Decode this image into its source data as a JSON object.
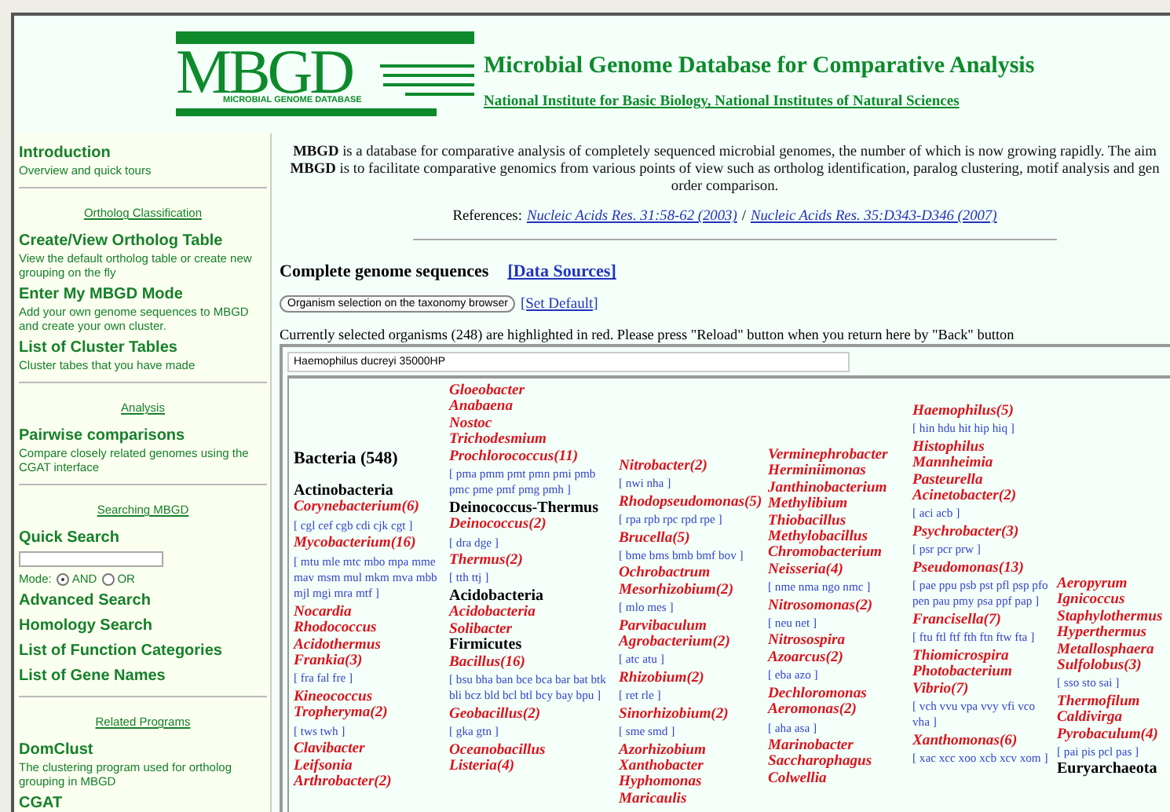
{
  "header": {
    "logo": {
      "letters": "MBGD",
      "caption": "MICROBIAL GENOME DATABASE"
    },
    "title": "Microbial Genome Database for Comparative Analysis",
    "subtitle": "National Institute for Basic Biology, National Institutes of Natural Sciences"
  },
  "sidebar": {
    "items": [
      {
        "kind": "link",
        "title": "Introduction",
        "description": "Overview and quick tours"
      },
      {
        "kind": "section",
        "label": "Ortholog Classification"
      },
      {
        "kind": "link",
        "title": "Create/View Ortholog Table",
        "description": "View the default ortholog table or create new grouping on the fly"
      },
      {
        "kind": "link",
        "title": "Enter My MBGD Mode",
        "description": "Add your own genome sequences to MBGD and create your own cluster."
      },
      {
        "kind": "link",
        "title": "List of Cluster Tables",
        "description": "Cluster tabes that you have made"
      },
      {
        "kind": "section",
        "label": "Analysis"
      },
      {
        "kind": "link",
        "title": "Pairwise comparisons",
        "description": "Compare closely related genomes using the CGAT interface"
      },
      {
        "kind": "section",
        "label": "Searching MBGD"
      },
      {
        "kind": "search",
        "title": "Quick Search",
        "mode_label": "Mode:",
        "options": [
          {
            "label": "AND",
            "selected": true
          },
          {
            "label": "OR",
            "selected": false
          }
        ]
      },
      {
        "kind": "link",
        "title": "Advanced Search"
      },
      {
        "kind": "link",
        "title": "Homology Search"
      },
      {
        "kind": "link",
        "title": "List of Function Categories"
      },
      {
        "kind": "link",
        "title": "List of Gene Names"
      },
      {
        "kind": "section",
        "label": "Related Programs"
      },
      {
        "kind": "link",
        "title": "DomClust",
        "description": "The clustering program used for ortholog grouping in MBGD"
      },
      {
        "kind": "link",
        "title": "CGAT"
      }
    ]
  },
  "intro": {
    "lines": [
      "**MBGD** is a database for comparative analysis of completely sequenced microbial genomes, the number of which is now growing rapidly. The aim",
      "**MBGD** is to facilitate comparative genomics from various points of view such as ortholog identification, paralog clustering, motif analysis and gen",
      "order comparison."
    ],
    "references_label": "References:",
    "references": [
      "Nucleic Acids Res. 31:58-62 (2003)",
      "Nucleic Acids Res. 35:D343-D346 (2007)"
    ],
    "separator": "/"
  },
  "genomes": {
    "heading": "Complete genome sequences",
    "data_sources": "[Data Sources]",
    "browser_button": "Organism selection on the taxonomy browser",
    "set_default": "[Set Default]",
    "notice": "Currently selected organisms (248) are highlighted in red. Please press \"Reload\" button when you return here by \"Back\" button",
    "organism_field": "Haemophilus ducreyi 35000HP",
    "columns": [
      {
        "entries": [
          {
            "kind": "domain",
            "text": "Bacteria (548)"
          },
          {
            "kind": "phylum",
            "text": "Actinobacteria"
          },
          {
            "kind": "genus",
            "text": "Corynebacterium(6)"
          },
          {
            "kind": "codes",
            "text": "[ cgl cef cgb cdi cjk cgt ]"
          },
          {
            "kind": "genus",
            "text": "Mycobacterium(16)"
          },
          {
            "kind": "codes",
            "text": "[ mtu mle mtc mbo mpa mme mav msm mul mkm mva mbb mjl mgi mra mtf ]"
          },
          {
            "kind": "genus",
            "text": "Nocardia"
          },
          {
            "kind": "genus",
            "text": "Rhodococcus"
          },
          {
            "kind": "genus",
            "text": "Acidothermus"
          },
          {
            "kind": "genus",
            "text": "Frankia(3)"
          },
          {
            "kind": "codes",
            "text": "[ fra fal fre ]"
          },
          {
            "kind": "genus",
            "text": "Kineococcus"
          },
          {
            "kind": "genus",
            "text": "Tropheryma(2)"
          },
          {
            "kind": "codes",
            "text": "[ tws twh ]"
          },
          {
            "kind": "genus",
            "text": "Clavibacter"
          },
          {
            "kind": "genus",
            "text": "Leifsonia"
          },
          {
            "kind": "genus",
            "text": "Arthrobacter(2)"
          }
        ]
      },
      {
        "entries": [
          {
            "kind": "genus",
            "text": "Gloeobacter"
          },
          {
            "kind": "genus",
            "text": "Anabaena"
          },
          {
            "kind": "genus",
            "text": "Nostoc"
          },
          {
            "kind": "genus",
            "text": "Trichodesmium"
          },
          {
            "kind": "genus",
            "text": "Prochlorococcus(11)"
          },
          {
            "kind": "codes",
            "text": "[ pma pmm pmt pmn pmi pmb pmc pme pmf pmg pmh ]"
          },
          {
            "kind": "phylum",
            "text": "Deinococcus-Thermus"
          },
          {
            "kind": "genus",
            "text": "Deinococcus(2)"
          },
          {
            "kind": "codes",
            "text": "[ dra dge ]"
          },
          {
            "kind": "genus",
            "text": "Thermus(2)"
          },
          {
            "kind": "codes",
            "text": "[ tth ttj ]"
          },
          {
            "kind": "phylum",
            "text": "Acidobacteria"
          },
          {
            "kind": "genus",
            "text": "Acidobacteria"
          },
          {
            "kind": "genus",
            "text": "Solibacter"
          },
          {
            "kind": "phylum",
            "text": "Firmicutes"
          },
          {
            "kind": "genus",
            "text": "Bacillus(16)"
          },
          {
            "kind": "codes",
            "text": "[ bsu bha ban bce bca bar bat btk bli bcz bld bcl btl bcy bay bpu ]"
          },
          {
            "kind": "genus",
            "text": "Geobacillus(2)"
          },
          {
            "kind": "codes",
            "text": "[ gka gtn ]"
          },
          {
            "kind": "genus",
            "text": "Oceanobacillus"
          },
          {
            "kind": "genus",
            "text": "Listeria(4)"
          }
        ]
      },
      {
        "entries": [
          {
            "kind": "genus",
            "text": "Nitrobacter(2)"
          },
          {
            "kind": "codes",
            "text": "[ nwi nha ]"
          },
          {
            "kind": "genus",
            "text": "Rhodopseudomonas(5)"
          },
          {
            "kind": "codes",
            "text": "[ rpa rpb rpc rpd rpe ]"
          },
          {
            "kind": "genus",
            "text": "Brucella(5)"
          },
          {
            "kind": "codes",
            "text": "[ bme bms bmb bmf bov ]"
          },
          {
            "kind": "genus",
            "text": "Ochrobactrum"
          },
          {
            "kind": "genus",
            "text": "Mesorhizobium(2)"
          },
          {
            "kind": "codes",
            "text": "[ mlo mes ]"
          },
          {
            "kind": "genus",
            "text": "Parvibaculum"
          },
          {
            "kind": "genus",
            "text": "Agrobacterium(2)"
          },
          {
            "kind": "codes",
            "text": "[ atc atu ]"
          },
          {
            "kind": "genus",
            "text": "Rhizobium(2)"
          },
          {
            "kind": "codes",
            "text": "[ ret rle ]"
          },
          {
            "kind": "genus",
            "text": "Sinorhizobium(2)"
          },
          {
            "kind": "codes",
            "text": "[ sme smd ]"
          },
          {
            "kind": "genus",
            "text": "Azorhizobium"
          },
          {
            "kind": "genus",
            "text": "Xanthobacter"
          },
          {
            "kind": "genus",
            "text": "Hyphomonas"
          },
          {
            "kind": "genus",
            "text": "Maricaulis"
          }
        ]
      },
      {
        "entries": [
          {
            "kind": "genus",
            "text": "Verminephrobacter"
          },
          {
            "kind": "genus",
            "text": "Herminiimonas"
          },
          {
            "kind": "genus",
            "text": "Janthinobacterium"
          },
          {
            "kind": "genus",
            "text": "Methylibium"
          },
          {
            "kind": "genus",
            "text": "Thiobacillus"
          },
          {
            "kind": "genus",
            "text": "Methylobacillus"
          },
          {
            "kind": "genus",
            "text": "Chromobacterium"
          },
          {
            "kind": "genus",
            "text": "Neisseria(4)"
          },
          {
            "kind": "codes",
            "text": "[ nme nma ngo nmc ]"
          },
          {
            "kind": "genus",
            "text": "Nitrosomonas(2)"
          },
          {
            "kind": "codes",
            "text": "[ neu net ]"
          },
          {
            "kind": "genus",
            "text": "Nitrosospira"
          },
          {
            "kind": "genus",
            "text": "Azoarcus(2)"
          },
          {
            "kind": "codes",
            "text": "[ eba azo ]"
          },
          {
            "kind": "genus",
            "text": "Dechloromonas"
          },
          {
            "kind": "genus",
            "text": "Aeromonas(2)"
          },
          {
            "kind": "codes",
            "text": "[ aha asa ]"
          },
          {
            "kind": "genus",
            "text": "Marinobacter"
          },
          {
            "kind": "genus",
            "text": "Saccharophagus"
          },
          {
            "kind": "genus",
            "text": "Colwellia"
          }
        ]
      },
      {
        "entries": [
          {
            "kind": "genus",
            "text": "Haemophilus(5)"
          },
          {
            "kind": "codes",
            "text": "[ hin hdu hit hip hiq ]"
          },
          {
            "kind": "genus",
            "text": "Histophilus"
          },
          {
            "kind": "genus",
            "text": "Mannheimia"
          },
          {
            "kind": "genus",
            "text": "Pasteurella"
          },
          {
            "kind": "genus",
            "text": "Acinetobacter(2)"
          },
          {
            "kind": "codes",
            "text": "[ aci acb ]"
          },
          {
            "kind": "genus",
            "text": "Psychrobacter(3)"
          },
          {
            "kind": "codes",
            "text": "[ psr pcr prw ]"
          },
          {
            "kind": "genus",
            "text": "Pseudomonas(13)"
          },
          {
            "kind": "codes",
            "text": "[ pae ppu psb pst pfl psp pfo pen pau pmy psa ppf pap ]"
          },
          {
            "kind": "genus",
            "text": "Francisella(7)"
          },
          {
            "kind": "codes",
            "text": "[ ftu ftl ftf fth ftn ftw fta ]"
          },
          {
            "kind": "genus",
            "text": "Thiomicrospira"
          },
          {
            "kind": "genus",
            "text": "Photobacterium"
          },
          {
            "kind": "genus",
            "text": "Vibrio(7)"
          },
          {
            "kind": "codes",
            "text": "[ vch vvu vpa vvy vfi vco vha ]"
          },
          {
            "kind": "genus",
            "text": "Xanthomonas(6)"
          },
          {
            "kind": "codes",
            "text": "[ xac xcc xoo xcb xcv xom ]"
          }
        ]
      },
      {
        "entries": [
          {
            "kind": "genus",
            "text": "Aeropyrum"
          },
          {
            "kind": "genus",
            "text": "Ignicoccus"
          },
          {
            "kind": "genus",
            "text": "Staphylothermus"
          },
          {
            "kind": "genus",
            "text": "Hyperthermus"
          },
          {
            "kind": "genus",
            "text": "Metallosphaera"
          },
          {
            "kind": "genus",
            "text": "Sulfolobus(3)"
          },
          {
            "kind": "codes",
            "text": "[ sso sto sai ]"
          },
          {
            "kind": "genus",
            "text": "Thermofilum"
          },
          {
            "kind": "genus",
            "text": "Caldivirga"
          },
          {
            "kind": "genus",
            "text": "Pyrobaculum(4)"
          },
          {
            "kind": "codes",
            "text": "[ pai pis pcl pas ]"
          },
          {
            "kind": "phylum",
            "text": "Euryarchaeota"
          }
        ]
      }
    ]
  }
}
